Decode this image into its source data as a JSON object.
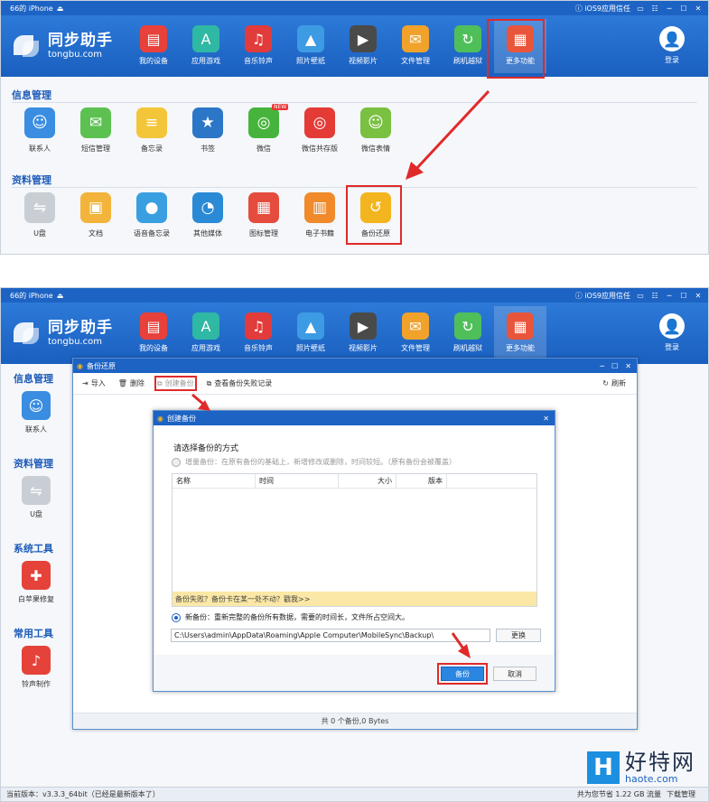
{
  "window": {
    "device": "66的 iPhone",
    "trust": "iOS9应用信任",
    "controls": [
      "▭",
      "☷",
      "─",
      "☐",
      "✕"
    ]
  },
  "logo": {
    "cn": "同步助手",
    "en": "tongbu.com"
  },
  "nav": [
    {
      "label": "我的设备",
      "icon": "store-icon",
      "glyph": "▤",
      "color": "#e8403a"
    },
    {
      "label": "应用游戏",
      "icon": "app-store-icon",
      "glyph": "A",
      "color": "#2fb8a3"
    },
    {
      "label": "音乐铃声",
      "icon": "music-icon",
      "glyph": "♫",
      "color": "#e23b3b"
    },
    {
      "label": "照片壁纸",
      "icon": "photo-icon",
      "glyph": "▲",
      "color": "#3d9be3"
    },
    {
      "label": "视频影片",
      "icon": "video-icon",
      "glyph": "▶",
      "color": "#4a4a4a"
    },
    {
      "label": "文件管理",
      "icon": "folder-icon",
      "glyph": "✉",
      "color": "#f0a22b"
    },
    {
      "label": "刷机越狱",
      "icon": "jailbreak-icon",
      "glyph": "↻",
      "color": "#4fbf5a"
    },
    {
      "label": "更多功能",
      "icon": "more-icon",
      "glyph": "▦",
      "color": "#e9553a"
    }
  ],
  "login": {
    "label": "登录"
  },
  "sections": {
    "info": {
      "title": "信息管理",
      "items": [
        {
          "label": "联系人",
          "icon": "contacts-icon",
          "glyph": "☺",
          "color": "#3a8de0"
        },
        {
          "label": "短信管理",
          "icon": "sms-icon",
          "glyph": "✉",
          "color": "#5cc151"
        },
        {
          "label": "备忘录",
          "icon": "notes-icon",
          "glyph": "≡",
          "color": "#f3c63a"
        },
        {
          "label": "书签",
          "icon": "bookmark-icon",
          "glyph": "★",
          "color": "#2b76c7"
        },
        {
          "label": "微信",
          "icon": "wechat-icon",
          "glyph": "◎",
          "color": "#46b43c",
          "badge": "NEW"
        },
        {
          "label": "微信共存版",
          "icon": "wechat-coexist-icon",
          "glyph": "◎",
          "color": "#e43b36"
        },
        {
          "label": "微信表情",
          "icon": "wechat-emoji-icon",
          "glyph": "☺",
          "color": "#7ac041"
        }
      ]
    },
    "data": {
      "title": "资料管理",
      "items": [
        {
          "label": "U盘",
          "icon": "usb-disk-icon",
          "glyph": "⇋",
          "color": "#c9ced4"
        },
        {
          "label": "文档",
          "icon": "document-icon",
          "glyph": "▣",
          "color": "#f2b43a"
        },
        {
          "label": "语音备忘录",
          "icon": "voice-memo-icon",
          "glyph": "●",
          "color": "#3a9fe0"
        },
        {
          "label": "其他媒体",
          "icon": "media-icon",
          "glyph": "◔",
          "color": "#2b8ad6"
        },
        {
          "label": "图标管理",
          "icon": "icon-manage-icon",
          "glyph": "▦",
          "color": "#e44c3d"
        },
        {
          "label": "电子书籍",
          "icon": "ebook-icon",
          "glyph": "▥",
          "color": "#f08a2a"
        },
        {
          "label": "备份还原",
          "icon": "backup-restore-icon",
          "glyph": "↺",
          "color": "#f3b51f"
        }
      ]
    }
  },
  "sidebar": [
    {
      "title": "信息管理",
      "label": "联系人",
      "icon": "contacts-icon",
      "glyph": "☺",
      "color": "#3a8de0"
    },
    {
      "title": "资料管理",
      "label": "U盘",
      "icon": "usb-disk-icon",
      "glyph": "⇋",
      "color": "#c9ced4"
    },
    {
      "title": "系统工具",
      "label": "白苹果修复",
      "icon": "apple-repair-icon",
      "glyph": "✚",
      "color": "#e5423a"
    },
    {
      "title": "常用工具",
      "label": "铃声制作",
      "icon": "bell-icon",
      "glyph": "♪",
      "color": "#e5423a"
    }
  ],
  "backup_dialog": {
    "title": "备份还原",
    "toolbar": {
      "import": "导入",
      "delete": "删除",
      "create": "创建备份",
      "fail_log": "查看备份失败记录",
      "refresh": "刷新"
    },
    "footer": "共 0 个备份,0 Bytes"
  },
  "create_dialog": {
    "title": "创建备份",
    "heading": "请选择备份的方式",
    "incremental": "增量备份：在原有备份的基础上，新增修改或删除，时间较短。（原有备份会被覆盖）",
    "columns": [
      "名称",
      "时间",
      "大小",
      "版本"
    ],
    "warning": "备份失败？备份卡在某一处不动？戳我>>",
    "new_backup": "新备份：重新完整的备份所有数据，需要的时间长，文件所占空间大。",
    "path": "C:\\Users\\admin\\AppData\\Roaming\\Apple Computer\\MobileSync\\Backup\\",
    "change": "更换",
    "backup": "备份",
    "cancel": "取消"
  },
  "status": {
    "version": "当前版本：v3.3.3_64bit（已经是最新版本了）",
    "saved": "共为您节省 1.22 GB 流量",
    "download": "下载管理"
  },
  "watermark": {
    "letter": "H",
    "cn": "好特网",
    "en": "haote.com"
  }
}
